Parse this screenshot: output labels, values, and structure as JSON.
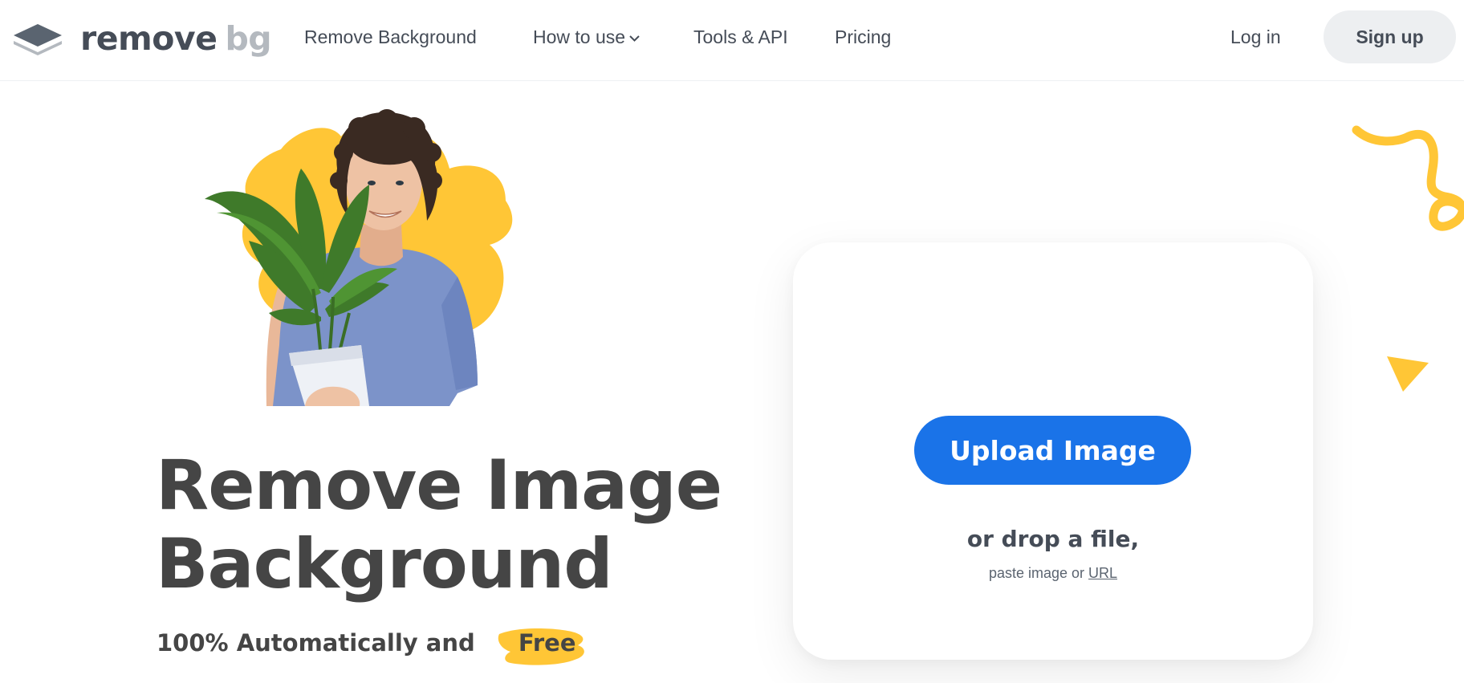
{
  "header": {
    "logo": {
      "word1": "remove",
      "word2": "bg",
      "icon": "layers-logo-icon"
    },
    "nav": [
      {
        "label": "Remove Background"
      },
      {
        "label": "How to use",
        "icon": "chevron-down-icon"
      },
      {
        "label": "Tools & API"
      },
      {
        "label": "Pricing"
      }
    ],
    "login_label": "Log in",
    "signup_label": "Sign up"
  },
  "hero": {
    "title_line1": "Remove Image",
    "title_line2": "Background",
    "subtitle_prefix": "100% Automatically and",
    "subtitle_highlight": "Free",
    "illustration": "man-holding-plant-photo"
  },
  "upload": {
    "button_label": "Upload Image",
    "drop_text": "or drop a file,",
    "paste_prefix": "paste image or",
    "url_label": "URL"
  },
  "colors": {
    "accent_blue": "#1a73e8",
    "accent_yellow": "#ffc636",
    "text_dark": "#454545",
    "logo_gray": "#b4b9bf",
    "signup_bg": "#edeff1"
  }
}
